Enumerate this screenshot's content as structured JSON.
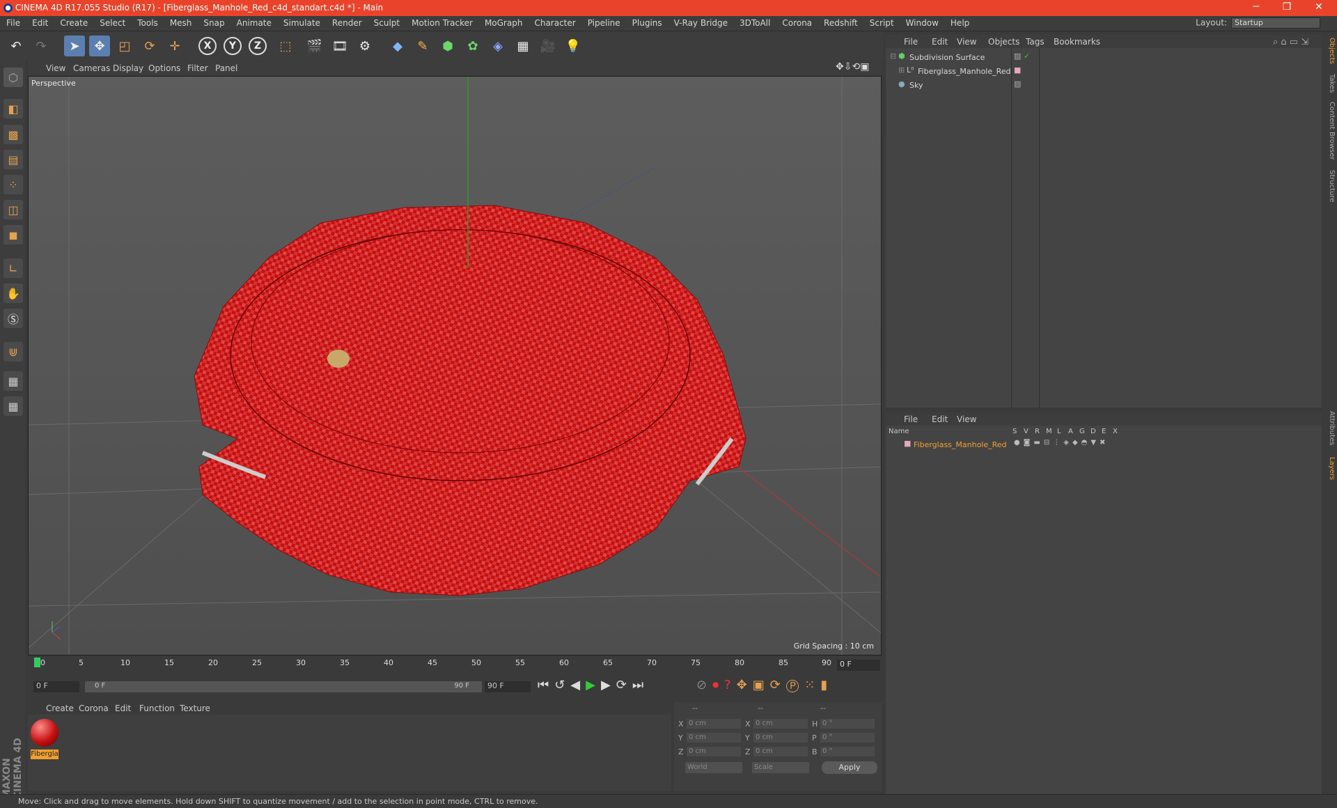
{
  "window": {
    "title": "CINEMA 4D R17.055 Studio (R17) - [Fiberglass_Manhole_Red_c4d_standart.c4d *] - Main",
    "minimize": "─",
    "maximize": "❐",
    "close": "✕"
  },
  "menu": [
    "File",
    "Edit",
    "Create",
    "Select",
    "Tools",
    "Mesh",
    "Snap",
    "Animate",
    "Simulate",
    "Render",
    "Sculpt",
    "Motion Tracker",
    "MoGraph",
    "Character",
    "Pipeline",
    "Plugins",
    "V-Ray Bridge",
    "3DToAll",
    "Corona",
    "Redshift",
    "Script",
    "Window",
    "Help"
  ],
  "layout": {
    "label": "Layout:",
    "value": "Startup"
  },
  "viewport": {
    "menu": [
      "View",
      "Cameras",
      "Display",
      "Options",
      "Filter",
      "Panel"
    ],
    "name": "Perspective",
    "grid_spacing": "Grid Spacing : 10 cm"
  },
  "timeline": {
    "ticks": [
      "0",
      "5",
      "10",
      "15",
      "20",
      "25",
      "30",
      "35",
      "40",
      "45",
      "50",
      "55",
      "60",
      "65",
      "70",
      "75",
      "80",
      "85",
      "90"
    ],
    "current_frame": "0 F",
    "start_field": "0 F",
    "range_start": "0 F",
    "range_end": "90 F",
    "end_field": "90 F"
  },
  "material_panel": {
    "menu": [
      "Create",
      "Corona",
      "Edit",
      "Function",
      "Texture"
    ],
    "material_name": "Fibergla"
  },
  "coords": {
    "headers": [
      "--",
      "--",
      "--"
    ],
    "rows": [
      {
        "a": "X",
        "av": "0 cm",
        "b": "X",
        "bv": "0 cm",
        "c": "H",
        "cv": "0 °"
      },
      {
        "a": "Y",
        "av": "0 cm",
        "b": "Y",
        "bv": "0 cm",
        "c": "P",
        "cv": "0 °"
      },
      {
        "a": "Z",
        "av": "0 cm",
        "b": "Z",
        "bv": "0 cm",
        "c": "B",
        "cv": "0 °"
      }
    ],
    "world": "World",
    "scale": "Scale",
    "apply": "Apply"
  },
  "objects_panel": {
    "menu": [
      "File",
      "Edit",
      "View",
      "Objects",
      "Tags",
      "Bookmarks"
    ],
    "items": [
      "Subdivision Surface",
      "Fiberglass_Manhole_Red",
      "Sky"
    ]
  },
  "layers_panel": {
    "menu": [
      "File",
      "Edit",
      "View"
    ],
    "columns": [
      "Name",
      "S",
      "V",
      "R",
      "M",
      "L",
      "A",
      "G",
      "D",
      "E",
      "X"
    ],
    "layer": "Fiberglass_Manhole_Red"
  },
  "right_tabs": [
    "Objects",
    "Takes",
    "Content Browser",
    "Structure",
    "Attributes",
    "Layers"
  ],
  "brand": "MAXON CINEMA 4D",
  "status": "Move: Click and drag to move elements. Hold down SHIFT to quantize movement / add to the selection in point mode, CTRL to remove.",
  "colors": {
    "titlebar": "#e9442b",
    "accent": "#5b7fb0",
    "layer_name": "#f0a030",
    "model": "#c41010"
  }
}
